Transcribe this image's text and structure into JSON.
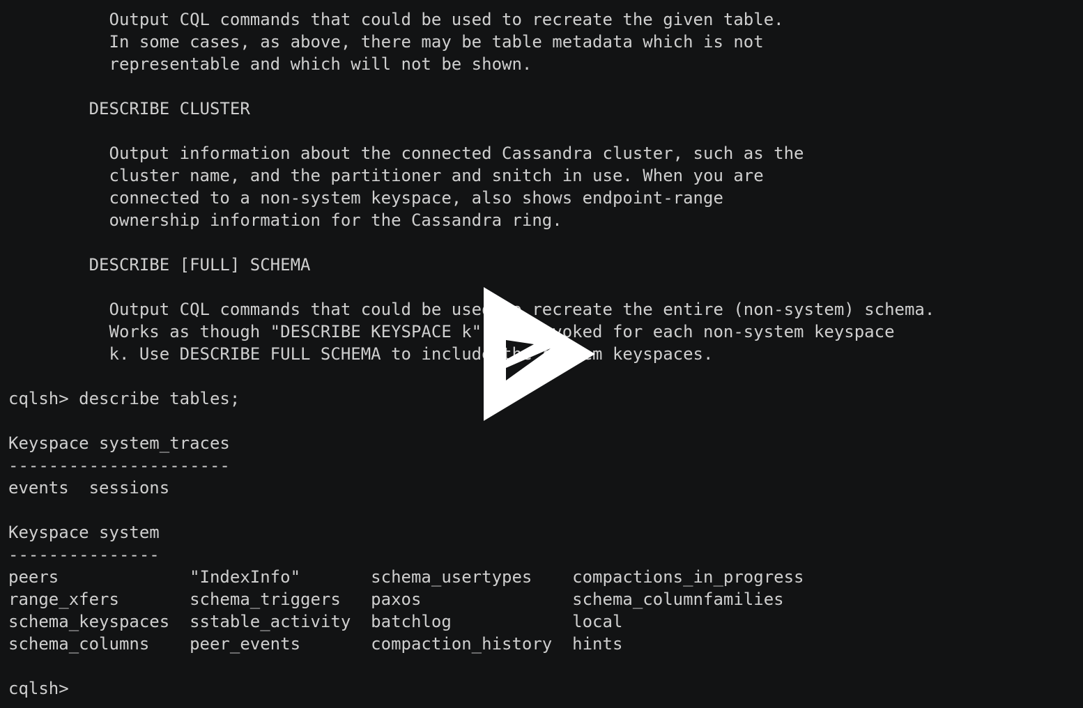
{
  "terminal": {
    "lines": [
      "          Output CQL commands that could be used to recreate the given table.",
      "          In some cases, as above, there may be table metadata which is not",
      "          representable and which will not be shown.",
      "",
      "        DESCRIBE CLUSTER",
      "",
      "          Output information about the connected Cassandra cluster, such as the",
      "          cluster name, and the partitioner and snitch in use. When you are",
      "          connected to a non-system keyspace, also shows endpoint-range",
      "          ownership information for the Cassandra ring.",
      "",
      "        DESCRIBE [FULL] SCHEMA",
      "",
      "          Output CQL commands that could be used to recreate the entire (non-system) schema.",
      "          Works as though \"DESCRIBE KEYSPACE k\" was invoked for each non-system keyspace",
      "          k. Use DESCRIBE FULL SCHEMA to include the system keyspaces.",
      "",
      "cqlsh> describe tables;",
      "",
      "Keyspace system_traces",
      "----------------------",
      "events  sessions",
      "",
      "Keyspace system",
      "---------------",
      "peers             \"IndexInfo\"       schema_usertypes    compactions_in_progress",
      "range_xfers       schema_triggers   paxos               schema_columnfamilies",
      "schema_keyspaces  sstable_activity  batchlog            local",
      "schema_columns    peer_events       compaction_history  hints",
      "",
      "cqlsh> "
    ]
  },
  "overlay": {
    "icon": "play-icon",
    "color": "#ffffff"
  }
}
